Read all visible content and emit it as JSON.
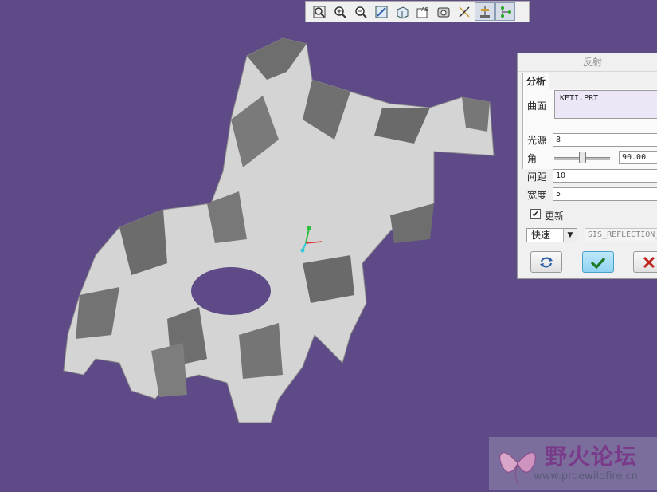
{
  "colors": {
    "viewport_bg": "#5d4a86",
    "model_light": "#e6e6e6",
    "model_dark": "#6e6e6e",
    "ok_button": "#8fd3f2"
  },
  "toolbar": {
    "buttons": [
      {
        "icon": "zoom-fit-icon"
      },
      {
        "icon": "zoom-in-icon"
      },
      {
        "icon": "zoom-out-icon"
      },
      {
        "icon": "repaint-icon"
      },
      {
        "icon": "display-style-icon"
      },
      {
        "icon": "saved-views-icon"
      },
      {
        "icon": "view-manager-icon"
      },
      {
        "icon": "datum-display-icon"
      },
      {
        "icon": "annotation-display-icon"
      },
      {
        "icon": "point-display-icon"
      }
    ]
  },
  "dialog": {
    "title": "反射",
    "tab_analysis": "分析",
    "surface_label": "曲面",
    "surface_value": "KETI.PRT",
    "light_label": "光源",
    "light_value": "8",
    "angle_label": "角",
    "angle_value": "90.00",
    "angle_slider_value": 90,
    "spacing_label": "间距",
    "spacing_value": "10",
    "width_label": "宽度",
    "width_value": "5",
    "update_label": "更新",
    "update_checked": true,
    "quick_label": "快速",
    "param_name": "SIS_REFLECTION_"
  },
  "watermark": {
    "title": "野火论坛",
    "url": "www.proewildfire.cn"
  }
}
